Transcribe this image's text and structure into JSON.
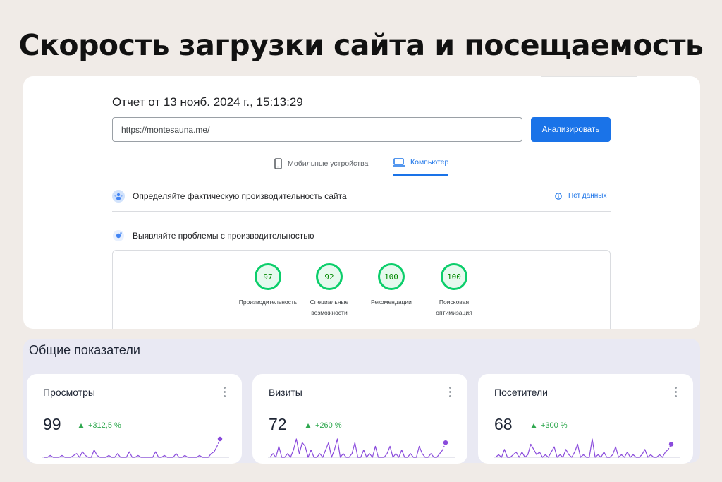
{
  "headline": "Скорость загрузки сайта и посещаемость",
  "pagespeed": {
    "report_title": "Отчет от 13 нояб. 2024 г., 15:13:29",
    "url_value": "https://montesauna.me/",
    "analyze_label": "Анализировать",
    "tabs": [
      {
        "label": "Мобильные устройства",
        "icon": "smartphone-icon",
        "active": false
      },
      {
        "label": "Компьютер",
        "icon": "laptop-icon",
        "active": true
      }
    ],
    "field_section": {
      "label": "Определяйте фактическую производительность сайта",
      "status": "Нет данных"
    },
    "lab_section": {
      "label": "Выявляйте проблемы с производительностью"
    },
    "scores": [
      {
        "value": "97",
        "label_line1": "Производительность",
        "label_line2": ""
      },
      {
        "value": "92",
        "label_line1": "Специальные",
        "label_line2": "возможности"
      },
      {
        "value": "100",
        "label_line1": "Рекомендации",
        "label_line2": ""
      },
      {
        "value": "100",
        "label_line1": "Поисковая",
        "label_line2": "оптимизация"
      }
    ],
    "colors": {
      "accent": "#1a73e8",
      "good": "#0cce6b"
    }
  },
  "metrics": {
    "section_title": "Общие показатели",
    "cards": [
      {
        "title": "Просмотры",
        "value": "99",
        "delta": "+312,5 %",
        "trend": [
          0,
          0,
          1,
          0,
          0,
          0,
          1,
          0,
          0,
          0,
          1,
          2,
          0,
          3,
          1,
          0,
          0,
          4,
          1,
          0,
          0,
          0,
          1,
          0,
          0,
          2,
          0,
          0,
          0,
          3,
          0,
          0,
          1,
          0,
          0,
          0,
          0,
          0,
          3,
          0,
          0,
          1,
          0,
          0,
          0,
          2,
          0,
          0,
          1,
          0,
          0,
          0,
          0,
          1,
          0,
          0,
          0,
          2,
          3,
          6,
          10
        ]
      },
      {
        "title": "Визиты",
        "value": "72",
        "delta": "+260 %",
        "trend": [
          0,
          1,
          0,
          3,
          0,
          0,
          1,
          0,
          2,
          5,
          1,
          4,
          3,
          0,
          2,
          0,
          0,
          1,
          0,
          2,
          4,
          0,
          2,
          5,
          0,
          1,
          0,
          0,
          1,
          4,
          0,
          0,
          2,
          0,
          1,
          0,
          3,
          0,
          0,
          0,
          1,
          3,
          0,
          1,
          0,
          2,
          0,
          0,
          1,
          0,
          0,
          3,
          1,
          0,
          0,
          1,
          0,
          0,
          1,
          2,
          4
        ]
      },
      {
        "title": "Посетители",
        "value": "68",
        "delta": "+300 %",
        "trend": [
          0,
          1,
          0,
          3,
          0,
          0,
          1,
          2,
          0,
          2,
          0,
          1,
          5,
          3,
          1,
          2,
          0,
          1,
          0,
          2,
          4,
          0,
          1,
          0,
          3,
          1,
          0,
          2,
          5,
          0,
          1,
          0,
          0,
          7,
          0,
          1,
          0,
          2,
          0,
          0,
          1,
          4,
          0,
          1,
          0,
          2,
          0,
          1,
          0,
          0,
          1,
          3,
          0,
          1,
          0,
          0,
          1,
          0,
          2,
          3,
          5
        ]
      }
    ],
    "colors": {
      "line": "#8a4bdc",
      "positive": "#2fa84f"
    }
  }
}
